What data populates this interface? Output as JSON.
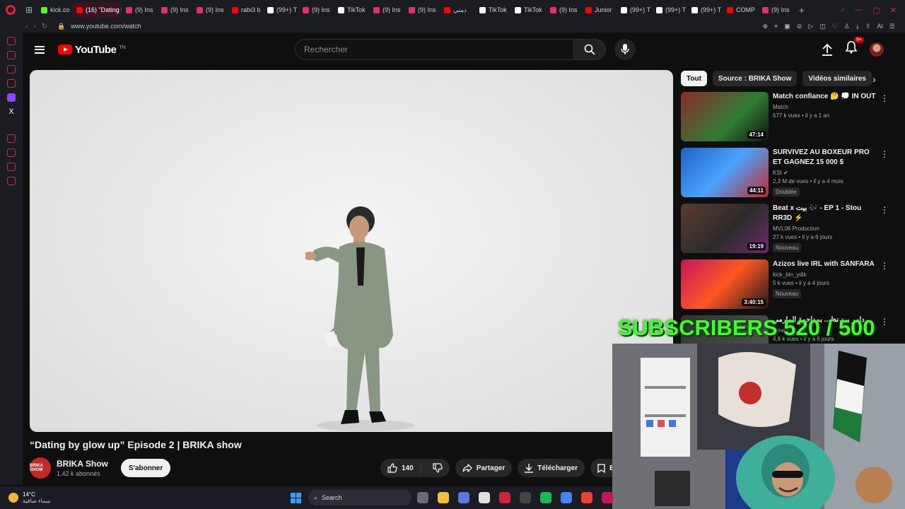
{
  "browser": {
    "tabs": [
      {
        "label": "kick.co",
        "color": "#53fc18",
        "active": false
      },
      {
        "label": "(16) \"Dating b",
        "color": "#ff0000",
        "active": true
      },
      {
        "label": "(9) Ins",
        "color": "#e1306c",
        "active": false
      },
      {
        "label": "(9) Ins",
        "color": "#e1306c",
        "active": false
      },
      {
        "label": "(9) Ins",
        "color": "#e1306c",
        "active": false
      },
      {
        "label": "rabi3 b",
        "color": "#ff0000",
        "active": false
      },
      {
        "label": "(99+) T",
        "color": "#ffffff",
        "active": false
      },
      {
        "label": "(9) Ins",
        "color": "#e1306c",
        "active": false
      },
      {
        "label": "TikTok",
        "color": "#ffffff",
        "active": false
      },
      {
        "label": "(9) Ins",
        "color": "#e1306c",
        "active": false
      },
      {
        "label": "(9) Ins",
        "color": "#e1306c",
        "active": false
      },
      {
        "label": "دمتي",
        "color": "#ff0000",
        "active": false
      },
      {
        "label": "TikTok",
        "color": "#ffffff",
        "active": false
      },
      {
        "label": "TikTok",
        "color": "#ffffff",
        "active": false
      },
      {
        "label": "(9) Ins",
        "color": "#e1306c",
        "active": false
      },
      {
        "label": "Junior",
        "color": "#ff0000",
        "active": false
      },
      {
        "label": "(99+) T",
        "color": "#ffffff",
        "active": false
      },
      {
        "label": "(99+) T",
        "color": "#ffffff",
        "active": false
      },
      {
        "label": "(99+) T",
        "color": "#ffffff",
        "active": false
      },
      {
        "label": "COMP",
        "color": "#ff0000",
        "active": false
      },
      {
        "label": "(9) Ins",
        "color": "#e1306c",
        "active": false
      }
    ],
    "url": "www.youtube.com/watch"
  },
  "header": {
    "logo_text": "YouTube",
    "logo_tm": "TN",
    "search_placeholder": "Rechercher",
    "notif_count": "9+"
  },
  "video": {
    "title": "“Dating by glow up” Episode 2 | BRIKA show",
    "channel_name": "BRIKA Show",
    "channel_avatar_text": "BRIKA SHOW",
    "subscribers": "1,42 k abonnés",
    "subscribe_label": "S'abonner",
    "like_count": "140",
    "share_label": "Partager",
    "download_label": "Télécharger",
    "save_label": "En"
  },
  "chips": [
    "Tout",
    "Source : BRIKA Show",
    "Vidéos similaires"
  ],
  "related": [
    {
      "title": "Match confiance 🤔 💭 IN OUT",
      "channel": "Match",
      "stats": "577 k vues • il y a 1 an",
      "badge": "",
      "duration": "47:14",
      "thumb": "linear-gradient(135deg,#8a2b2b,#2e7d32 60%,#111)"
    },
    {
      "title": "SURVIVEZ AU BOXEUR PRO ET GAGNEZ 15 000 $",
      "channel": "KSI ✔",
      "stats": "2,3 M de vues • il y a 4 mois",
      "badge": "Doublée",
      "duration": "44:11",
      "thumb": "linear-gradient(135deg,#1e63c4,#4aa3ff 50%,#c62828)"
    },
    {
      "title": "Beat x بيت 🎶 - EP 1 - Stou RR3D ⚡",
      "channel": "MVL06 Production",
      "stats": "27 k vues • il y a 6 jours",
      "badge": "Nouveau",
      "duration": "19:19",
      "thumb": "linear-gradient(135deg,#5a3b30,#2b2b2b 55%,#6b2b6b)"
    },
    {
      "title": "Azizos live IRL with SANFARA",
      "channel": "kick_bin_ydik",
      "stats": "5 k vues • il y a 4 jours",
      "badge": "Nouveau",
      "duration": "3:40:15",
      "thumb": "linear-gradient(135deg,#c2185b,#ff5722 50%,#1a1a1a)"
    },
    {
      "title": "دامر برد نظ... بمداحمة المارمي",
      "channel": "Ome...",
      "stats": "4,8 k vues • il y a 6 jours",
      "badge": "",
      "duration": "",
      "thumb": "linear-gradient(135deg,#333,#555)"
    }
  ],
  "overlay": {
    "subscribers_goal": "SUBSCRIBERS 520 / 500"
  },
  "taskbar": {
    "temp": "14°C",
    "weather": "سماء صافية",
    "search_label": "Search"
  }
}
